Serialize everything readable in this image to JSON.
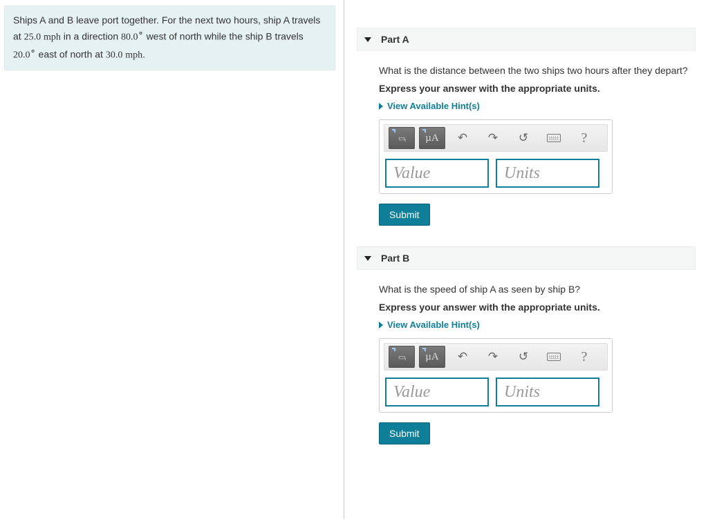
{
  "problem": {
    "pre1": "Ships A and B leave port together. For the next two hours, ship A travels at ",
    "v1": "25.0",
    "u1": "mph",
    "mid1": " in a direction ",
    "a1": "80.0",
    "deg": "∘",
    "dir1": " west of north while the ship B travels ",
    "a2": "20.0",
    "dir2": " east of north at ",
    "v2": "30.0",
    "u2": "mph",
    "end": "."
  },
  "hints_label": "View Available Hint(s)",
  "submit_label": "Submit",
  "value_ph": "Value",
  "units_ph": "Units",
  "toolbar": {
    "tmpl": "T···",
    "mu": "µA",
    "undo": "↶",
    "redo": "↷",
    "reset": "↺",
    "help": "?"
  },
  "partA": {
    "title": "Part A",
    "question": "What is the distance between the two ships two hours after they depart?",
    "instr": "Express your answer with the appropriate units."
  },
  "partB": {
    "title": "Part B",
    "question": "What is the speed of ship A as seen by ship B?",
    "instr": "Express your answer with the appropriate units."
  }
}
